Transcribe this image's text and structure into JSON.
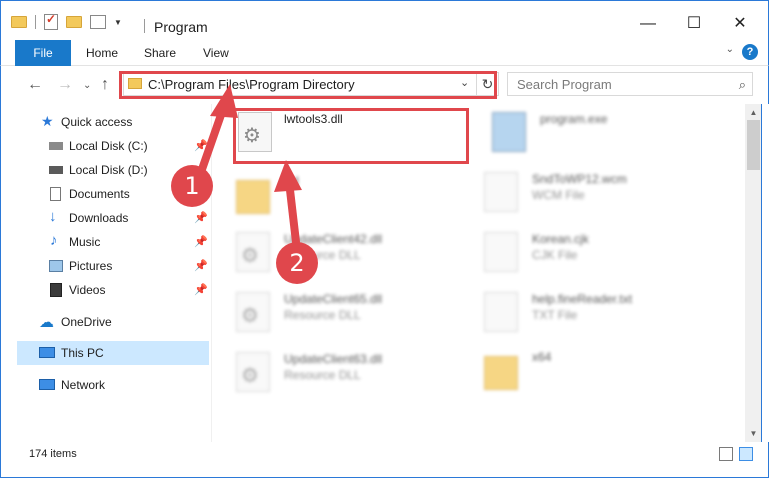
{
  "window": {
    "title": "Program",
    "minimize": "—",
    "maximize": "☐",
    "close": "✕"
  },
  "ribbon": {
    "tabs": [
      "File",
      "Home",
      "Share",
      "View"
    ]
  },
  "address": {
    "path": "C:\\Program Files\\Program Directory",
    "search_placeholder": "Search Program"
  },
  "sidebar": {
    "items": [
      {
        "label": "Quick access",
        "icon": "star-icon",
        "pinned": false
      },
      {
        "label": "Local Disk (C:)",
        "icon": "drive-icon",
        "pinned": true
      },
      {
        "label": "Local Disk (D:)",
        "icon": "drive-icon",
        "pinned": false
      },
      {
        "label": "Documents",
        "icon": "documents-icon",
        "pinned": true
      },
      {
        "label": "Downloads",
        "icon": "download-icon",
        "pinned": true
      },
      {
        "label": "Music",
        "icon": "music-icon",
        "pinned": true
      },
      {
        "label": "Pictures",
        "icon": "pictures-icon",
        "pinned": true
      },
      {
        "label": "Videos",
        "icon": "videos-icon",
        "pinned": true
      },
      {
        "label": "OneDrive",
        "icon": "cloud-icon",
        "pinned": false
      },
      {
        "label": "This PC",
        "icon": "computer-icon",
        "pinned": false
      },
      {
        "label": "Network",
        "icon": "network-icon",
        "pinned": false
      }
    ]
  },
  "files": {
    "left": [
      {
        "name": "lwtools3.dll",
        "type": ""
      },
      {
        "name": "Ed",
        "type": ""
      },
      {
        "name": "UpdateClient42.dll",
        "type": "Resource DLL"
      },
      {
        "name": "UpdateClient65.dll",
        "type": "Resource DLL"
      },
      {
        "name": "UpdateClient63.dll",
        "type": "Resource DLL"
      }
    ],
    "right": [
      {
        "name": "program.exe",
        "type": ""
      },
      {
        "name": "SndToWP12.wcm",
        "type": "WCM File"
      },
      {
        "name": "Korean.cjk",
        "type": "CJK File"
      },
      {
        "name": "help.fineReader.txt",
        "type": "TXT File"
      },
      {
        "name": "x64",
        "type": ""
      }
    ]
  },
  "status": {
    "item_count": "174 items"
  },
  "annotations": {
    "badge1": "1",
    "badge2": "2"
  },
  "colors": {
    "accent": "#1979ca",
    "highlight": "#e0474c",
    "selection": "#cce8ff"
  }
}
